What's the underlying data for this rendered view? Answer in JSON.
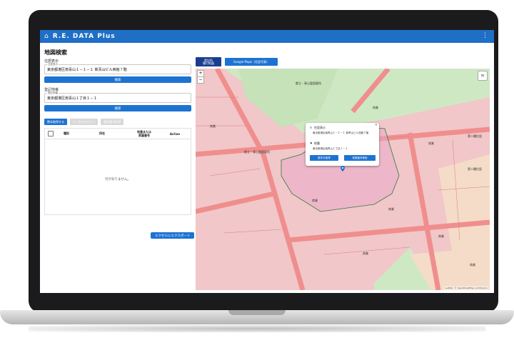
{
  "app": {
    "title": "R.E. DATA Plus",
    "menu_icon": "⋮"
  },
  "left": {
    "heading": "地図検索",
    "address_label": "住居表示",
    "address_legend": "住居表示",
    "address_value": "東京都港区南青山１－１－１ 新青山ビル西館７階",
    "search1": "検索",
    "lot_label": "登記地番",
    "lot_legend": "登記地番",
    "lot_value": "東京都港区南青山１丁目１－１",
    "search2": "検索",
    "btn_add": "謄本取得する",
    "btn_disabled1": "ピンを外す(ピン)",
    "btn_disabled2": "登記番号取得",
    "columns": [
      "",
      "種別",
      "所在",
      "地番または\n家屋番号",
      "Action"
    ],
    "empty": "行がありません。",
    "export": "エクセルにエクスポート"
  },
  "map": {
    "btn_chiban": "登記所\n備付地図",
    "btn_google": "Google Maps（住居写真）",
    "zoom_in": "+",
    "zoom_out": "−",
    "attribution": "Leaflet | © OpenStreetMap contributors",
    "labels": [
      "都立・青山霊園墓所",
      "都立・青山霊園墓所",
      "商業",
      "商業",
      "商業",
      "商業",
      "商業",
      "商業",
      "商業",
      "商業",
      "第二種住居",
      "第二種住居"
    ],
    "popup": {
      "addr_label": "住居表示",
      "addr_value": "東京都港区南青山１－１－１ 新青山ビル西館７階",
      "lot_label": "地番",
      "lot_value": "東京都港区南青山１丁目１－１",
      "btn1": "謄本を取得",
      "btn2": "家屋番号検索",
      "close": "×"
    }
  },
  "colors": {
    "accent": "#1e73d2",
    "appbar": "#1f6fc7",
    "zone_commercial": "#f1c7c9",
    "zone_green": "#cfe8c4",
    "road": "#f28e8e"
  }
}
